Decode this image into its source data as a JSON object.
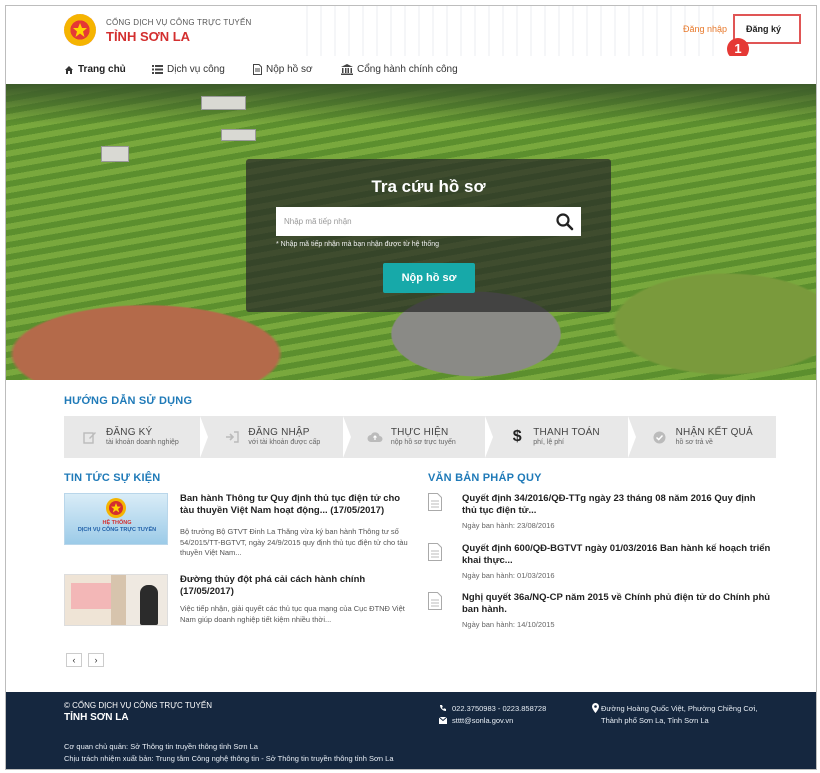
{
  "header": {
    "portal_sub": "CỔNG DỊCH VỤ CÔNG TRỰC TUYẾN",
    "portal_main": "TỈNH SƠN LA",
    "login": "Đăng nhập",
    "register": "Đăng ký",
    "callout_number": "1"
  },
  "nav": {
    "items": [
      {
        "label": "Trang chủ",
        "icon": "home-icon"
      },
      {
        "label": "Dịch vụ công",
        "icon": "list-icon"
      },
      {
        "label": "Nộp hồ sơ",
        "icon": "document-icon"
      },
      {
        "label": "Cổng hành chính công",
        "icon": "building-icon"
      }
    ]
  },
  "search": {
    "title": "Tra cứu hồ sơ",
    "placeholder": "Nhập mã tiếp nhận",
    "hint": "* Nhập mã tiếp nhận mà bạn nhận được từ hệ thống",
    "submit": "Nộp hồ sơ"
  },
  "guide": {
    "title": "HƯỚNG DẪN SỬ DỤNG",
    "steps": [
      {
        "title": "ĐĂNG KÝ",
        "sub": "tài khoản doanh nghiệp",
        "icon": "edit-icon"
      },
      {
        "title": "ĐĂNG NHẬP",
        "sub": "với tài khoản được cấp",
        "icon": "login-icon"
      },
      {
        "title": "THỰC HIỆN",
        "sub": "nộp hồ sơ trực tuyến",
        "icon": "cloud-upload-icon"
      },
      {
        "title": "THANH TOÁN",
        "sub": "phí, lệ phí",
        "icon": "dollar-icon"
      },
      {
        "title": "NHẬN KẾT QUẢ",
        "sub": "hồ sơ trả về",
        "icon": "check-circle-icon"
      }
    ]
  },
  "news": {
    "title": "TIN TỨC SỰ KIỆN",
    "thumb1_caption_top": "HỆ THỐNG",
    "thumb1_caption": "DỊCH VỤ CÔNG TRỰC TUYẾN",
    "items": [
      {
        "title": "Ban hành Thông tư Quy định thủ tục điện tử cho tàu thuyền Việt Nam hoạt động... (17/05/2017)",
        "desc": "Bộ trưởng Bộ GTVT Đinh La Thăng vừa ký ban hành Thông tư số 54/2015/TT-BGTVT, ngày 24/9/2015 quy định thủ tục điện tử cho tàu thuyền Việt Nam..."
      },
      {
        "title": "Đường thủy đột phá cải cách hành chính (17/05/2017)",
        "desc": "Việc tiếp nhận, giải quyết các thủ tục qua mạng của Cục ĐTNĐ Việt Nam giúp doanh nghiệp tiết kiệm nhiều thời..."
      }
    ],
    "prev": "‹",
    "next": "›"
  },
  "docs": {
    "title": "VĂN BẢN PHÁP QUY",
    "items": [
      {
        "title": "Quyết định 34/2016/QĐ-TTg ngày 23 tháng 08 năm 2016 Quy định thủ tục điện tử...",
        "date": "Ngày ban hành: 23/08/2016"
      },
      {
        "title": "Quyết định 600/QĐ-BGTVT ngày 01/03/2016 Ban hành kế hoạch triển khai thực...",
        "date": "Ngày ban hành: 01/03/2016"
      },
      {
        "title": "Nghị quyết 36a/NQ-CP năm 2015 về Chính phủ điện tử do Chính phủ ban hành.",
        "date": "Ngày ban hành: 14/10/2015"
      }
    ]
  },
  "footer": {
    "org_line": "© CỔNG DỊCH VỤ CÔNG TRỰC TUYẾN",
    "org_name": "TỈNH SƠN LA",
    "phone": "022.3750983 - 0223.858728",
    "email": "stttt@sonla.gov.vn",
    "address1": "Đường Hoàng Quốc Việt, Phường Chiềng Cơi,",
    "address2": "Thành phố Sơn La, Tỉnh Sơn La",
    "managing": "Cơ quan chủ quản: Sở Thông tin truyền thông tỉnh Sơn La",
    "publisher": "Chịu trách nhiệm xuất bản: Trung tâm Công nghệ thông tin - Sở Thông tin truyền thông tỉnh Sơn La"
  },
  "colors": {
    "brand_red": "#d32f2f",
    "section_blue": "#1f7ab8",
    "teal_button": "#17a9a9",
    "footer_navy": "#15273f",
    "login_orange": "#e8792b"
  }
}
